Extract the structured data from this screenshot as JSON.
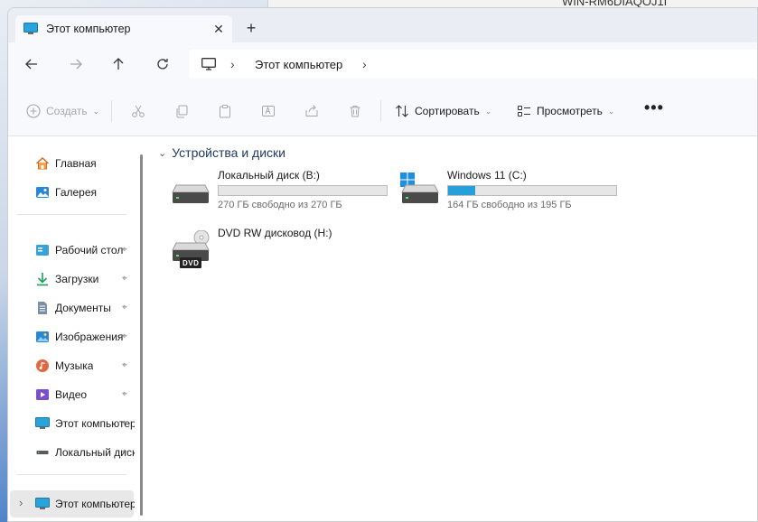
{
  "background": {
    "other_window_title": "WIN-RM6DIAQOJ1I"
  },
  "tab": {
    "title": "Этот компьютер",
    "close_glyph": "✕",
    "new_tab_glyph": "+"
  },
  "nav": {
    "back_glyph": "←",
    "forward_glyph": "→",
    "up_glyph": "↑",
    "refresh_glyph": "↻",
    "address": {
      "chevron": "›",
      "location": "Этот компьютер"
    }
  },
  "toolbar": {
    "new_label": "Создать",
    "sort_label": "Сортировать",
    "view_label": "Просмотреть",
    "caret": "⌄",
    "more_glyph": "•••"
  },
  "sidebar": {
    "top_items": [
      {
        "label": "Главная",
        "icon": "home-icon"
      },
      {
        "label": "Галерея",
        "icon": "gallery-icon"
      }
    ],
    "pinned_items": [
      {
        "label": "Рабочий стол",
        "icon": "desktop-icon"
      },
      {
        "label": "Загрузки",
        "icon": "downloads-icon"
      },
      {
        "label": "Документы",
        "icon": "documents-icon"
      },
      {
        "label": "Изображения",
        "icon": "pictures-icon"
      },
      {
        "label": "Музыка",
        "icon": "music-icon"
      },
      {
        "label": "Видео",
        "icon": "videos-icon"
      },
      {
        "label": "Этот компьютер",
        "icon": "pc-icon"
      },
      {
        "label": "Локальный диск (B:)",
        "icon": "drive-icon"
      }
    ],
    "pin_glyph": "📌",
    "tree_item": {
      "label": "Этот компьютер",
      "expand_glyph": "›"
    }
  },
  "content": {
    "group_title": "Устройства и диски",
    "group_chevron": "⌄",
    "drives": [
      {
        "name": "Локальный диск (B:)",
        "free_text": "270 ГБ свободно из 270 ГБ",
        "used_fraction": 0.0,
        "type": "hdd"
      },
      {
        "name": "Windows 11 (C:)",
        "free_text": "164 ГБ свободно из 195 ГБ",
        "used_fraction": 0.16,
        "type": "system"
      },
      {
        "name": "DVD RW дисковод (H:)",
        "free_text": "",
        "used_fraction": null,
        "type": "dvd",
        "badge": "DVD"
      }
    ]
  },
  "colors": {
    "accent": "#26a0da",
    "selection": "#e8e8e8"
  }
}
